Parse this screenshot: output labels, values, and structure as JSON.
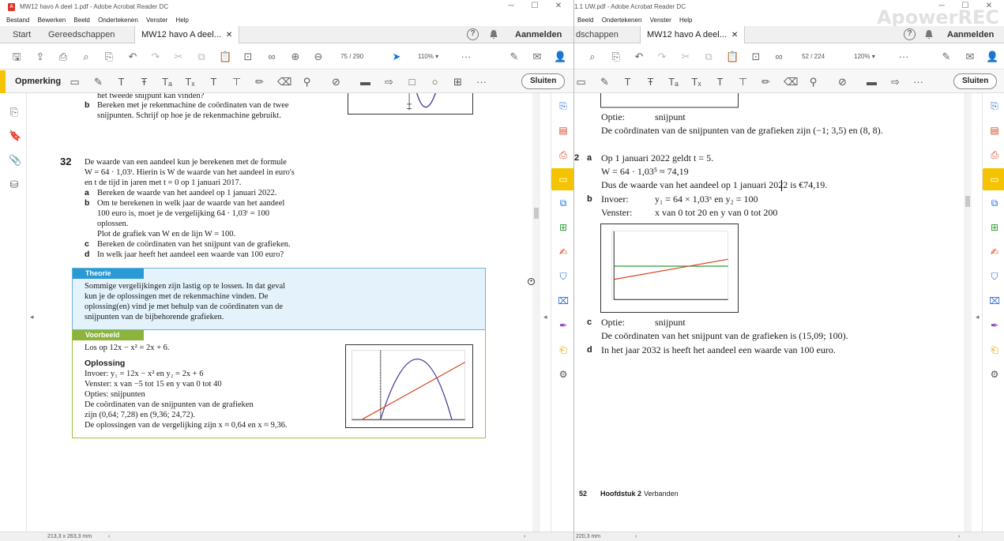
{
  "left": {
    "title": "MW12 havo A deel 1.pdf - Adobe Acrobat Reader DC",
    "menu": [
      "Bestand",
      "Bewerken",
      "Beeld",
      "Ondertekenen",
      "Venster",
      "Help"
    ],
    "tabs": {
      "start": "Start",
      "tools": "Gereedschappen",
      "doc": "MW12 havo A deel..."
    },
    "signin": "Aanmelden",
    "page_current": "75",
    "page_total": "/ 290",
    "zoom": "110%",
    "comment_label": "Opmerking",
    "close_label": "Sluiten",
    "status": "213,3 x 263,3 mm",
    "doc": {
      "top1": "het tweede snijpunt kan vinden?",
      "top_b_letter": "b",
      "top_b1": "Bereken met je rekenmachine de coördinaten van de twee",
      "top_b2": "snijpunten. Schrijf op hoe je de rekenmachine gebruikt.",
      "q_number": "32",
      "q_intro1": "De waarde van een aandeel kun je berekenen met de formule",
      "q_intro2": "W = 64 · 1,03ᵗ. Hierin is W de waarde van het aandeel in euro's",
      "q_intro3": "en t de tijd in jaren met t = 0 op 1 januari 2017.",
      "qa_letter": "a",
      "qa": "Bereken de waarde van het aandeel op 1 januari 2022.",
      "qb_letter": "b",
      "qb1": "Om te berekenen in welk jaar de waarde van het aandeel",
      "qb2": "100 euro is, moet je de vergelijking 64 · 1,03ᵗ = 100",
      "qb3": "oplossen.",
      "qb4": "Plot de grafiek van W en de lijn W = 100.",
      "qc_letter": "c",
      "qc": "Bereken de coördinaten van het snijpunt van de grafieken.",
      "qd_letter": "d",
      "qd": "In welk jaar heeft het aandeel een waarde van 100 euro?",
      "theorie_hdr": "Theorie",
      "theorie1": "Sommige vergelijkingen zijn lastig op te lossen. In dat geval",
      "theorie2": "kun je de oplossingen met de rekenmachine vinden. De",
      "theorie3": "oplossing(en) vind je met behulp van de coördinaten van de",
      "theorie4": "snijpunten van de bijbehorende grafieken.",
      "voorbeeld_hdr": "Voorbeeld",
      "vb_los": "Los op 12x − x² = 2x + 6.",
      "vb_opl": "Oplossing",
      "vb_invoer": "Invoer:      y₁ = 12x − x² en y₂ = 2x + 6",
      "vb_venster": "Venster:    x van −5 tot 15 en y van 0 tot 40",
      "vb_opties": "Opties:      snijpunten",
      "vb_coord1": "De coördinaten van de snijpunten van de grafieken",
      "vb_coord2": "zijn (0,64; 7,28) en (9,36; 24,72).",
      "vb_oplos": "De oplossingen van de vergelijking zijn x ≈ 0,64 en x ≈ 9,36."
    }
  },
  "right": {
    "title": "1.1 UW.pdf - Adobe Acrobat Reader DC",
    "menu": [
      "Beeld",
      "Ondertekenen",
      "Venster",
      "Help"
    ],
    "tabs": {
      "tools": "dschappen",
      "doc": "MW12 havo A deel..."
    },
    "signin": "Aanmelden",
    "page_current": "52",
    "page_total": "/ 224",
    "zoom": "120%",
    "close_label": "Sluiten",
    "status": "220,3 mm",
    "watermark": "ApowerREC",
    "doc": {
      "optie_top_lbl": "Optie:",
      "optie_top_val": "snijpunt",
      "coord_top": "De coördinaten van de snijpunten van de grafieken zijn (−1; 3,5) en (8, 8).",
      "num": "2",
      "a_letter": "a",
      "a1": "Op 1 januari 2022 geldt t = 5.",
      "a2": "W = 64 · 1,03⁵ ≈ 74,19",
      "a3": "Dus de waarde van het aandeel op 1 januari 2022 is €74,19.",
      "b_letter": "b",
      "b_invoer_lbl": "Invoer:",
      "b_invoer_val": "y₁ = 64 × 1,03ˣ en y₂ = 100",
      "b_venster_lbl": "Venster:",
      "b_venster_val": "x van 0 tot 20 en y van 0 tot 200",
      "c_letter": "c",
      "c_optie_lbl": "Optie:",
      "c_optie_val": "snijpunt",
      "c_text": "De coördinaten van het snijpunt van de grafieken is (15,09; 100).",
      "d_letter": "d",
      "d_text": "In het jaar 2032 is heeft het aandeel een waarde van 100 euro.",
      "footer_num": "52",
      "footer_ch": "Hoofdstuk 2",
      "footer_title": "Verbanden"
    }
  },
  "colors": {
    "accent_yellow": "#f5c400",
    "theorie_blue": "#2a9ad6",
    "voorbeeld_green": "#8cb43a",
    "graph_red": "#d9431e",
    "graph_blue": "#4a3fa0",
    "graph_green": "#2e9a3a"
  }
}
